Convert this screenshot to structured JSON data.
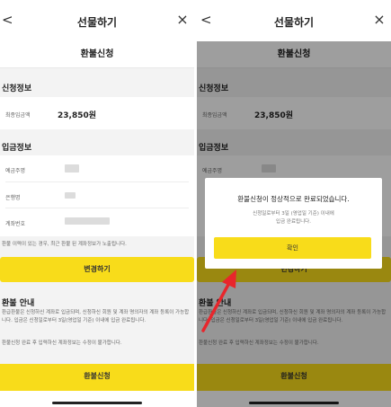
{
  "header": {
    "title": "선물하기",
    "close": "×",
    "back": "<"
  },
  "subheader": "환불신청",
  "apply_info": {
    "section_title": "신청정보",
    "amount_label": "최종입금액",
    "amount_value": "23,850원"
  },
  "deposit_info": {
    "section_title": "입금정보",
    "rows": [
      {
        "label": "예금주명"
      },
      {
        "label": "은행명"
      },
      {
        "label": "계좌번호"
      }
    ],
    "notice": "환불 이력이 있는 경우, 최근 환불 된 계좌정보가 노출됩니다.",
    "change_button": "변경하기"
  },
  "guide": {
    "title": "환불 안내",
    "text1": "환급환불은 신청하신 계좌로 입금되며, 신청하신 회원 및 계좌 명의자의 계좌 등록이 가능합니다. 입금은 신청일로부터 3일(영업일 기준) 이내에 입금 완료됩니다.",
    "text2": "환불신청 완료 후 입력하신 계좌정보는 수정이 불가합니다."
  },
  "submit_button": "환불신청",
  "modal": {
    "title": "환불신청이 정상적으로 완료되었습니다.",
    "desc_line1": "신청일로부터 3일 (영업일 기준) 이내에",
    "desc_line2": "입금 완료됩니다.",
    "confirm": "확인"
  },
  "colors": {
    "accent": "#f8dc1a",
    "arrow": "#e8262c",
    "dim": "rgba(0,0,0,0.38)"
  }
}
